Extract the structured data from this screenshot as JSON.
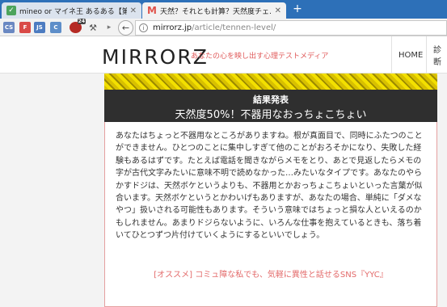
{
  "tabs": [
    {
      "label": "mineo or マイネ王 あるある【第…",
      "active": false
    },
    {
      "label": "天然？それとも計算？天然度チェ…",
      "active": true
    }
  ],
  "new_tab_symbol": "+",
  "extensions": {
    "cs": "CS",
    "f": "F",
    "js": "JS",
    "c": "C",
    "badge": "24"
  },
  "address_bar": {
    "host": "mirrorz.jp",
    "path": "/article/tennen-level/"
  },
  "site": {
    "logo": "MIRRORZ",
    "tagline": "あなたの心を映し出す心理テストメディア",
    "nav": [
      "HOME",
      "診断"
    ]
  },
  "result": {
    "label": "結果発表",
    "type": "天然度50%！不器用なおっちょこちょい",
    "text": "あなたはちょっと不器用なところがありますね。根が真面目で、同時にふたつのことができません。ひとつのことに集中しすぎて他のことがおろそかになり、失敗した経験もあるはずです。たとえば電話を聞きながらメモをとり、あとで見返したらメモの字が古代文字みたいに意味不明で読めなかった…みたいなタイプです。あなたのやらかすドジは、天然ボケというよりも、不器用とかおっちょこちょいといった言葉が似合います。天然ボケというとかわいげもありますが、あなたの場合、単純に「ダメなやつ」扱いされる可能性もあります。そういう意味ではちょっと損な人といえるのかもしれません。あまりドジらないように、いろんな仕事を抱えているときも、落ち着いてひとつずつ片付けていくようにするといいでしょう。",
    "promo": "[オススメ] コミュ障な私でも、気軽に異性と話せるSNS『YYC』"
  },
  "colors": {
    "tabstrip": "#2d70b8",
    "accent": "#e05a5a",
    "result_header": "#2f2f2f"
  }
}
